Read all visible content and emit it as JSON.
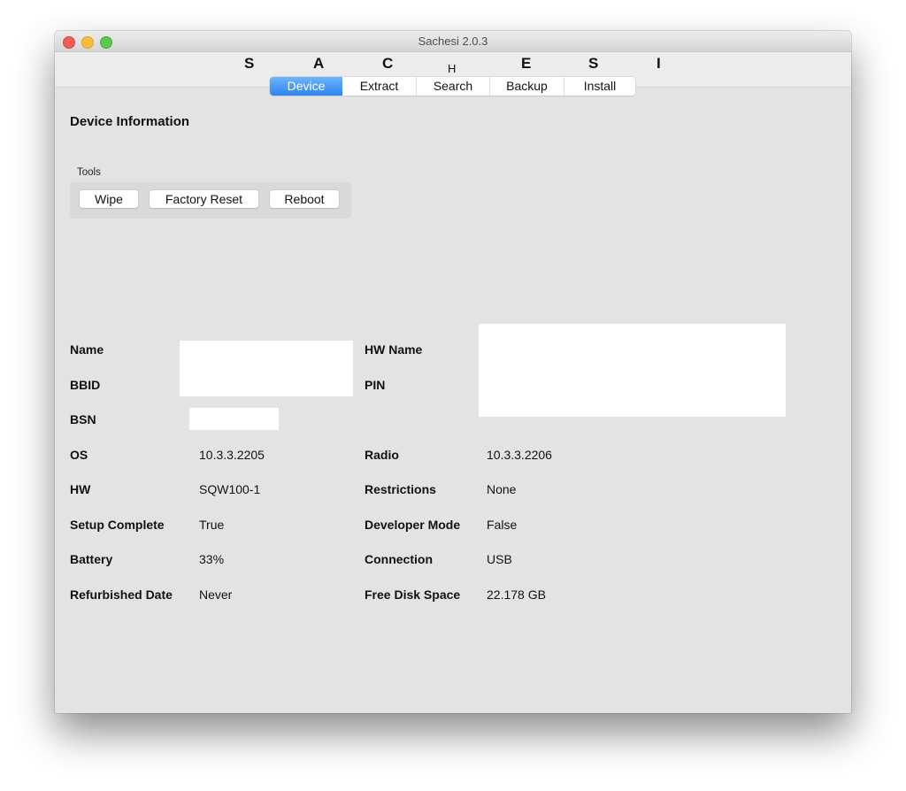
{
  "window": {
    "title": "Sachesi 2.0.3"
  },
  "banner": {
    "letters": [
      "S",
      "A",
      "C",
      "H",
      "E",
      "S",
      "I"
    ]
  },
  "tabs": [
    {
      "label": "Device",
      "active": true
    },
    {
      "label": "Extract",
      "active": false
    },
    {
      "label": "Search",
      "active": false
    },
    {
      "label": "Backup",
      "active": false
    },
    {
      "label": "Install",
      "active": false
    }
  ],
  "device": {
    "section_title": "Device Information",
    "tools": {
      "label": "Tools",
      "buttons": [
        "Wipe",
        "Factory Reset",
        "Reboot"
      ]
    },
    "redacted_fields": {
      "name_label": "Name",
      "bbid_label": "BBID",
      "bsn_label": "BSN",
      "hw_name_label": "HW Name",
      "pin_label": "PIN"
    },
    "info_left": [
      {
        "label": "OS",
        "value": "10.3.3.2205"
      },
      {
        "label": "HW",
        "value": "SQW100-1"
      },
      {
        "label": "Setup Complete",
        "value": "True"
      },
      {
        "label": "Battery",
        "value": "33%"
      },
      {
        "label": "Refurbished Date",
        "value": "Never"
      }
    ],
    "info_right": [
      {
        "label": "Radio",
        "value": "10.3.3.2206"
      },
      {
        "label": "Restrictions",
        "value": "None"
      },
      {
        "label": "Developer Mode",
        "value": "False"
      },
      {
        "label": "Connection",
        "value": "USB"
      },
      {
        "label": "Free Disk Space",
        "value": "22.178 GB"
      }
    ]
  }
}
